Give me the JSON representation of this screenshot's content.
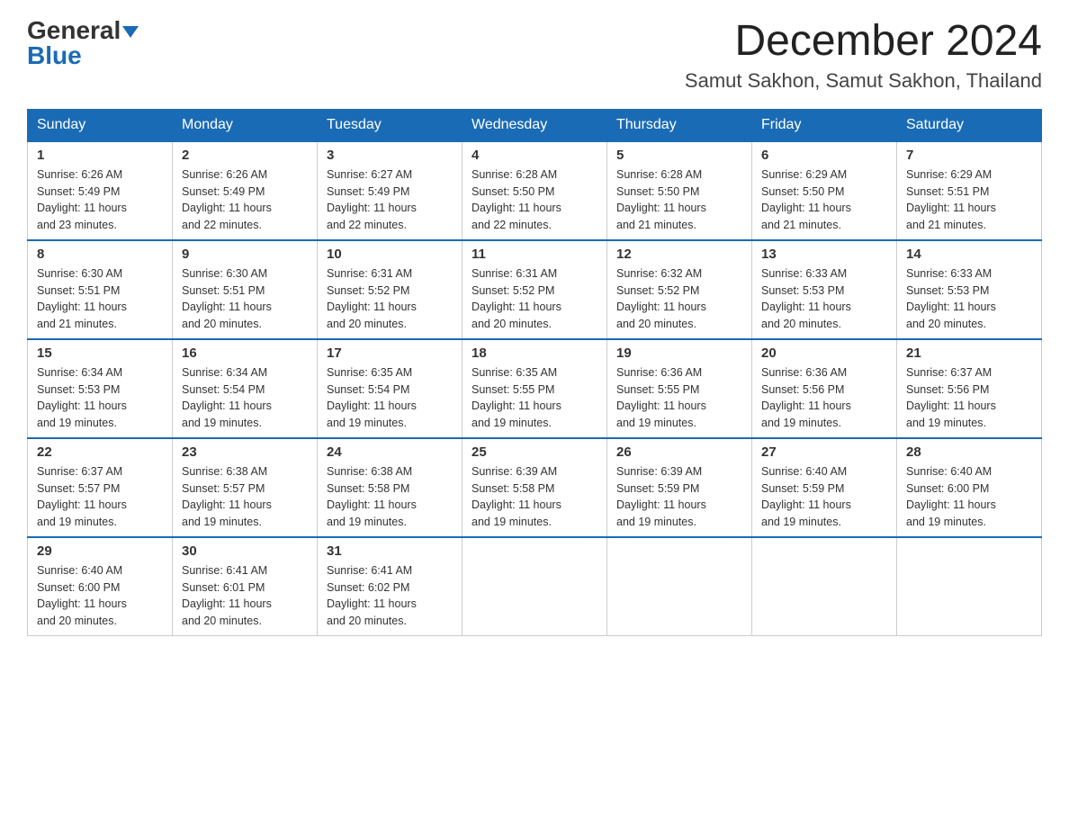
{
  "logo": {
    "text1": "General",
    "text2": "Blue"
  },
  "title": "December 2024",
  "location": "Samut Sakhon, Samut Sakhon, Thailand",
  "days_of_week": [
    "Sunday",
    "Monday",
    "Tuesday",
    "Wednesday",
    "Thursday",
    "Friday",
    "Saturday"
  ],
  "weeks": [
    [
      {
        "day": "1",
        "sunrise": "6:26 AM",
        "sunset": "5:49 PM",
        "daylight": "11 hours and 23 minutes."
      },
      {
        "day": "2",
        "sunrise": "6:26 AM",
        "sunset": "5:49 PM",
        "daylight": "11 hours and 22 minutes."
      },
      {
        "day": "3",
        "sunrise": "6:27 AM",
        "sunset": "5:49 PM",
        "daylight": "11 hours and 22 minutes."
      },
      {
        "day": "4",
        "sunrise": "6:28 AM",
        "sunset": "5:50 PM",
        "daylight": "11 hours and 22 minutes."
      },
      {
        "day": "5",
        "sunrise": "6:28 AM",
        "sunset": "5:50 PM",
        "daylight": "11 hours and 21 minutes."
      },
      {
        "day": "6",
        "sunrise": "6:29 AM",
        "sunset": "5:50 PM",
        "daylight": "11 hours and 21 minutes."
      },
      {
        "day": "7",
        "sunrise": "6:29 AM",
        "sunset": "5:51 PM",
        "daylight": "11 hours and 21 minutes."
      }
    ],
    [
      {
        "day": "8",
        "sunrise": "6:30 AM",
        "sunset": "5:51 PM",
        "daylight": "11 hours and 21 minutes."
      },
      {
        "day": "9",
        "sunrise": "6:30 AM",
        "sunset": "5:51 PM",
        "daylight": "11 hours and 20 minutes."
      },
      {
        "day": "10",
        "sunrise": "6:31 AM",
        "sunset": "5:52 PM",
        "daylight": "11 hours and 20 minutes."
      },
      {
        "day": "11",
        "sunrise": "6:31 AM",
        "sunset": "5:52 PM",
        "daylight": "11 hours and 20 minutes."
      },
      {
        "day": "12",
        "sunrise": "6:32 AM",
        "sunset": "5:52 PM",
        "daylight": "11 hours and 20 minutes."
      },
      {
        "day": "13",
        "sunrise": "6:33 AM",
        "sunset": "5:53 PM",
        "daylight": "11 hours and 20 minutes."
      },
      {
        "day": "14",
        "sunrise": "6:33 AM",
        "sunset": "5:53 PM",
        "daylight": "11 hours and 20 minutes."
      }
    ],
    [
      {
        "day": "15",
        "sunrise": "6:34 AM",
        "sunset": "5:53 PM",
        "daylight": "11 hours and 19 minutes."
      },
      {
        "day": "16",
        "sunrise": "6:34 AM",
        "sunset": "5:54 PM",
        "daylight": "11 hours and 19 minutes."
      },
      {
        "day": "17",
        "sunrise": "6:35 AM",
        "sunset": "5:54 PM",
        "daylight": "11 hours and 19 minutes."
      },
      {
        "day": "18",
        "sunrise": "6:35 AM",
        "sunset": "5:55 PM",
        "daylight": "11 hours and 19 minutes."
      },
      {
        "day": "19",
        "sunrise": "6:36 AM",
        "sunset": "5:55 PM",
        "daylight": "11 hours and 19 minutes."
      },
      {
        "day": "20",
        "sunrise": "6:36 AM",
        "sunset": "5:56 PM",
        "daylight": "11 hours and 19 minutes."
      },
      {
        "day": "21",
        "sunrise": "6:37 AM",
        "sunset": "5:56 PM",
        "daylight": "11 hours and 19 minutes."
      }
    ],
    [
      {
        "day": "22",
        "sunrise": "6:37 AM",
        "sunset": "5:57 PM",
        "daylight": "11 hours and 19 minutes."
      },
      {
        "day": "23",
        "sunrise": "6:38 AM",
        "sunset": "5:57 PM",
        "daylight": "11 hours and 19 minutes."
      },
      {
        "day": "24",
        "sunrise": "6:38 AM",
        "sunset": "5:58 PM",
        "daylight": "11 hours and 19 minutes."
      },
      {
        "day": "25",
        "sunrise": "6:39 AM",
        "sunset": "5:58 PM",
        "daylight": "11 hours and 19 minutes."
      },
      {
        "day": "26",
        "sunrise": "6:39 AM",
        "sunset": "5:59 PM",
        "daylight": "11 hours and 19 minutes."
      },
      {
        "day": "27",
        "sunrise": "6:40 AM",
        "sunset": "5:59 PM",
        "daylight": "11 hours and 19 minutes."
      },
      {
        "day": "28",
        "sunrise": "6:40 AM",
        "sunset": "6:00 PM",
        "daylight": "11 hours and 19 minutes."
      }
    ],
    [
      {
        "day": "29",
        "sunrise": "6:40 AM",
        "sunset": "6:00 PM",
        "daylight": "11 hours and 20 minutes."
      },
      {
        "day": "30",
        "sunrise": "6:41 AM",
        "sunset": "6:01 PM",
        "daylight": "11 hours and 20 minutes."
      },
      {
        "day": "31",
        "sunrise": "6:41 AM",
        "sunset": "6:02 PM",
        "daylight": "11 hours and 20 minutes."
      },
      null,
      null,
      null,
      null
    ]
  ],
  "labels": {
    "sunrise": "Sunrise:",
    "sunset": "Sunset:",
    "daylight": "Daylight:"
  }
}
